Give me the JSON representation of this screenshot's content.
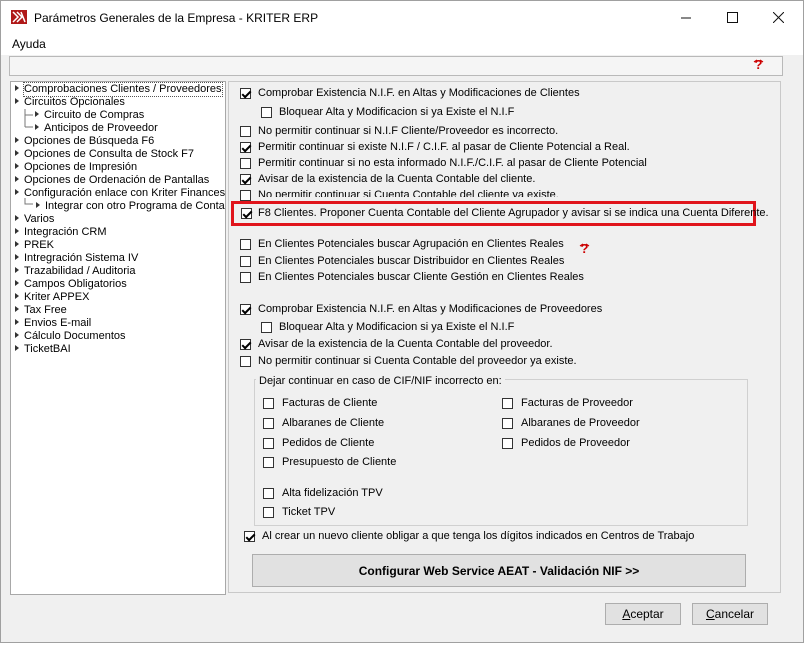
{
  "window": {
    "title": "Parámetros Generales de la Empresa - KRITER ERP",
    "minimize": "—",
    "maximize": "☐",
    "close": "✕"
  },
  "menu": {
    "help": "Ayuda"
  },
  "tree": {
    "items": [
      "Comprobaciones Clientes / Proveedores",
      "Circuitos Opcionales",
      "Circuito de Compras",
      "Anticipos de Proveedor",
      "Opciones de Búsqueda F6",
      "Opciones de Consulta de Stock F7",
      "Opciones de Impresión",
      "Opciones de Ordenación de Pantallas",
      "Configuración enlace con Kriter Finances",
      "Integrar con otro Programa de Contabi",
      "Varios",
      "Integración CRM",
      "PREK",
      "Intregración Sistema IV",
      "Trazabilidad / Auditoria",
      "Campos Obligatorios",
      "Kriter APPEX",
      "Tax Free",
      "Envios E-mail",
      "Cálculo Documentos",
      "TicketBAI"
    ]
  },
  "options": {
    "c1": "Comprobar Existencia N.I.F. en Altas y Modificaciones de Clientes",
    "c2": "Bloquear Alta y Modificacion si ya Existe el N.I.F",
    "c3": "No permitir continuar si N.I.F Cliente/Proveedor es incorrecto.",
    "c4": "Permitir continuar si existe N.I.F / C.I.F. al pasar de Cliente Potencial a Real.",
    "c5": "Permitir continuar si no esta informado N.I.F./C.I.F. al pasar de Cliente Potencial",
    "c6": "Avisar de la existencia de la Cuenta Contable del cliente.",
    "c7": "No permitir continuar si Cuenta Contable del cliente ya existe.",
    "c8": "F8 Clientes. Proponer Cuenta Contable del Cliente Agrupador y avisar si se indica una Cuenta Diferente.",
    "c9": "En Clientes Potenciales buscar Agrupación en Clientes Reales",
    "c10": "En Clientes Potenciales buscar Distribuidor en Clientes Reales",
    "c11": "En Clientes Potenciales buscar Cliente Gestión en Clientes Reales",
    "c12": "Comprobar Existencia N.I.F. en Altas y Modificaciones de Proveedores",
    "c13": "Bloquear Alta y Modificacion si ya Existe el N.I.F",
    "c14": "Avisar de la existencia de la Cuenta Contable del proveedor.",
    "c15": "No permitir continuar si Cuenta Contable del proveedor ya existe.",
    "c16": "Al crear un nuevo cliente obligar a que tenga los dígitos indicados en Centros de Trabajo"
  },
  "group": {
    "title": "Dejar continuar en caso de CIF/NIF incorrecto en:",
    "g1": "Facturas de Cliente",
    "g2": "Albaranes de Cliente",
    "g3": "Pedidos de Cliente",
    "g4": "Presupuesto de Cliente",
    "g5": "Alta fidelización TPV",
    "g6": "Ticket TPV",
    "g7": "Facturas de Proveedor",
    "g8": "Albaranes de Proveedor",
    "g9": "Pedidos de Proveedor"
  },
  "buttons": {
    "aeat": "Configurar Web Service AEAT - Validación NIF >>",
    "accept_u": "A",
    "accept_rest": "ceptar",
    "cancel_u": "C",
    "cancel_rest": "ancelar"
  },
  "colors": {
    "highlight": "#e0141b",
    "help_icon": "#cc0000"
  }
}
